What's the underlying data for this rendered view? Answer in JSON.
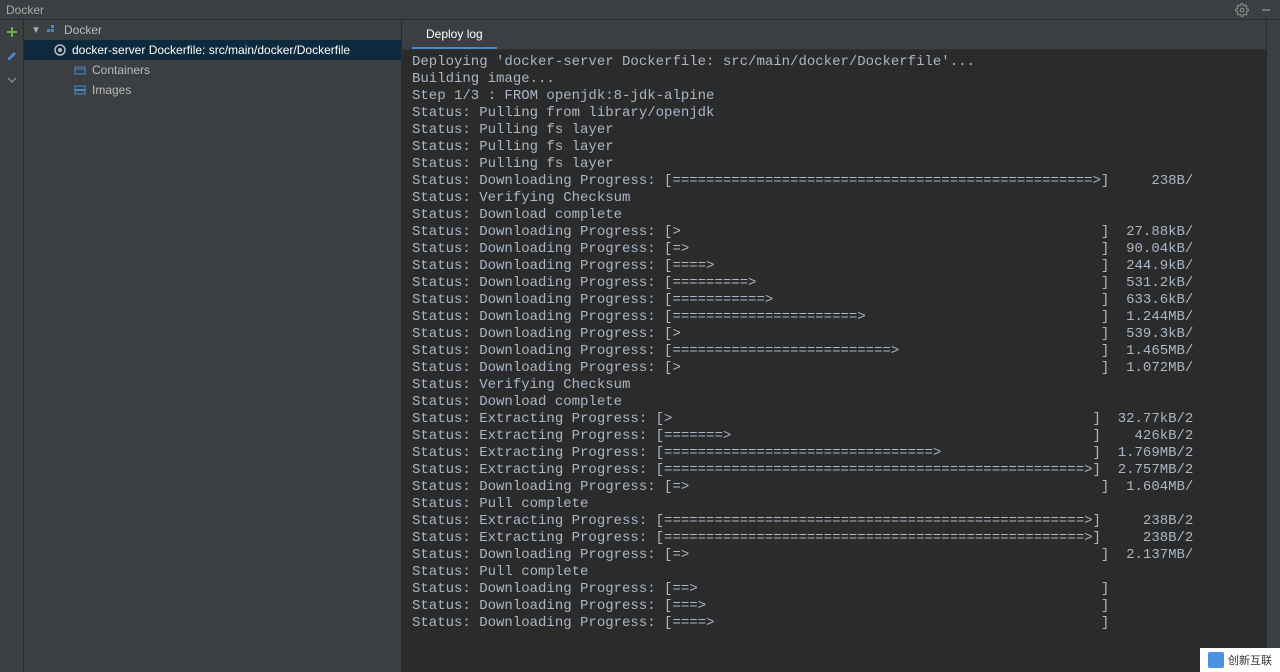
{
  "titlebar": {
    "title": "Docker"
  },
  "sidebar": {
    "root": {
      "label": "Docker"
    },
    "items": [
      {
        "label": "docker-server Dockerfile: src/main/docker/Dockerfile",
        "selected": true,
        "indent": 1,
        "icon": "dockerfile"
      },
      {
        "label": "Containers",
        "selected": false,
        "indent": 2,
        "icon": "container"
      },
      {
        "label": "Images",
        "selected": false,
        "indent": 2,
        "icon": "image"
      }
    ]
  },
  "tabs": {
    "active": "Deploy log"
  },
  "log_lines": [
    "Deploying 'docker-server Dockerfile: src/main/docker/Dockerfile'...",
    "Building image...",
    "Step 1/3 : FROM openjdk:8-jdk-alpine",
    "",
    "",
    "Status: Pulling from library/openjdk",
    "Status: Pulling fs layer",
    "Status: Pulling fs layer",
    "Status: Pulling fs layer",
    "Status: Downloading Progress: [==================================================>]     238B/",
    "Status: Verifying Checksum",
    "Status: Download complete",
    "Status: Downloading Progress: [>                                                  ]  27.88kB/",
    "Status: Downloading Progress: [=>                                                 ]  90.04kB/",
    "Status: Downloading Progress: [====>                                              ]  244.9kB/",
    "Status: Downloading Progress: [=========>                                         ]  531.2kB/",
    "Status: Downloading Progress: [===========>                                       ]  633.6kB/",
    "Status: Downloading Progress: [======================>                            ]  1.244MB/",
    "Status: Downloading Progress: [>                                                  ]  539.3kB/",
    "Status: Downloading Progress: [==========================>                        ]  1.465MB/",
    "Status: Downloading Progress: [>                                                  ]  1.072MB/",
    "Status: Verifying Checksum",
    "Status: Download complete",
    "Status: Extracting Progress: [>                                                  ]  32.77kB/2",
    "Status: Extracting Progress: [=======>                                           ]    426kB/2",
    "Status: Extracting Progress: [================================>                  ]  1.769MB/2",
    "Status: Extracting Progress: [==================================================>]  2.757MB/2",
    "Status: Downloading Progress: [=>                                                 ]  1.604MB/",
    "Status: Pull complete",
    "Status: Extracting Progress: [==================================================>]     238B/2",
    "Status: Extracting Progress: [==================================================>]     238B/2",
    "Status: Downloading Progress: [=>                                                 ]  2.137MB/",
    "Status: Pull complete",
    "Status: Downloading Progress: [==>                                                ]",
    "Status: Downloading Progress: [===>                                               ]",
    "Status: Downloading Progress: [====>                                              ]"
  ],
  "watermark": {
    "text": "创新互联"
  }
}
